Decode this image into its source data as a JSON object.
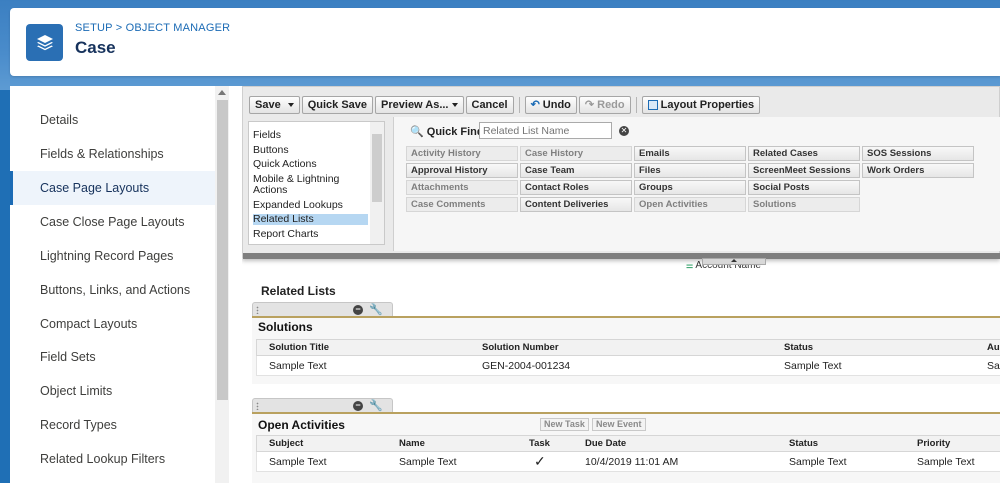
{
  "header": {
    "breadcrumb": "SETUP > OBJECT MANAGER",
    "title": "Case"
  },
  "sidebar": {
    "items": [
      {
        "label": "Details"
      },
      {
        "label": "Fields & Relationships"
      },
      {
        "label": "Case Page Layouts"
      },
      {
        "label": "Case Close Page Layouts"
      },
      {
        "label": "Lightning Record Pages"
      },
      {
        "label": "Buttons, Links, and Actions"
      },
      {
        "label": "Compact Layouts"
      },
      {
        "label": "Field Sets"
      },
      {
        "label": "Object Limits"
      },
      {
        "label": "Record Types"
      },
      {
        "label": "Related Lookup Filters"
      }
    ],
    "active_index": 2
  },
  "toolbar": {
    "save": "Save",
    "quick_save": "Quick Save",
    "preview_as": "Preview As...",
    "cancel": "Cancel",
    "undo": "Undo",
    "redo": "Redo",
    "layout_properties": "Layout Properties"
  },
  "palette": {
    "categories": [
      "Fields",
      "Buttons",
      "Quick Actions",
      "Mobile & Lightning Actions",
      "Expanded Lookups",
      "Related Lists",
      "Report Charts"
    ],
    "selected_category": "Related Lists",
    "quick_find_label": "Quick Find",
    "quick_find_placeholder": "Related List Name",
    "tiles": [
      {
        "label": "Activity History",
        "used": true
      },
      {
        "label": "Case History",
        "used": true
      },
      {
        "label": "Emails",
        "used": false
      },
      {
        "label": "Related Cases",
        "used": false
      },
      {
        "label": "SOS Sessions",
        "used": false
      },
      {
        "label": "Approval History",
        "used": false
      },
      {
        "label": "Case Team",
        "used": false
      },
      {
        "label": "Files",
        "used": false
      },
      {
        "label": "ScreenMeet Sessions",
        "used": false
      },
      {
        "label": "Work Orders",
        "used": false
      },
      {
        "label": "Attachments",
        "used": true
      },
      {
        "label": "Contact Roles",
        "used": false
      },
      {
        "label": "Groups",
        "used": false
      },
      {
        "label": "Social Posts",
        "used": false
      },
      {
        "label": "Case Comments",
        "used": true
      },
      {
        "label": "Content Deliveries",
        "used": false
      },
      {
        "label": "Open Activities",
        "used": true
      },
      {
        "label": "Solutions",
        "used": true
      }
    ]
  },
  "layout": {
    "account_name_field": "Account Name",
    "related_lists_title": "Related Lists",
    "solutions": {
      "name": "Solutions",
      "columns": [
        "Solution Title",
        "Solution Number",
        "Status",
        "Au"
      ],
      "row": [
        "Sample Text",
        "GEN-2004-001234",
        "Sample Text",
        "Sa"
      ]
    },
    "open_activities": {
      "name": "Open Activities",
      "new_task": "New Task",
      "new_event": "New Event",
      "columns": [
        "Subject",
        "Name",
        "Task",
        "Due Date",
        "Status",
        "Priority"
      ],
      "row": [
        "Sample Text",
        "Sample Text",
        "✓",
        "10/4/2019 11:01 AM",
        "Sample Text",
        "Sample Text"
      ]
    }
  },
  "colors": {
    "brand_blue": "#1b6bb5",
    "header_band": "#4a8ccb",
    "related_list_accent": "#b9a15f"
  }
}
